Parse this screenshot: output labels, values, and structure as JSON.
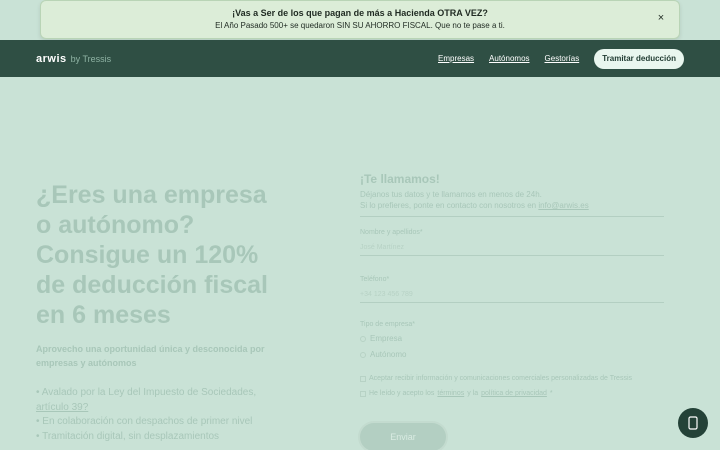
{
  "banner": {
    "title": "¡Vas a Ser de los que pagan de más a Hacienda OTRA VEZ?",
    "text": "El Año Pasado 500+ se quedaron SIN SU AHORRO FISCAL. Que no te pase a ti.",
    "close_glyph": "×"
  },
  "header": {
    "brand_main": "arwis",
    "brand_sub": "by Tressis",
    "nav": [
      "Empresas",
      "Autónomos",
      "Gestorías"
    ],
    "cta": "Tramitar deducción"
  },
  "hero": {
    "title_lines": [
      "¿Eres una empresa",
      "o autónomo?",
      "Consigue un 120%",
      "de deducción fiscal",
      "en 6 meses"
    ],
    "subtitle": "Aprovecho una oportunidad única y desconocida por empresas y autónomos",
    "bullets": [
      {
        "text": "• Avalado por la Ley del Impuesto de Sociedades,",
        "link": "artículo 39?"
      },
      {
        "text": "• En colaboración con despachos de primer nivel",
        "link": ""
      },
      {
        "text": "• Tramitación digital, sin desplazamientos",
        "link": ""
      }
    ]
  },
  "form": {
    "title": "¡Te llamamos!",
    "desc_line1": "Déjanos tus datos y te llamamos en menos de 24h.",
    "desc_line2_prefix": "Si lo prefieres, ponte en contacto con nosotros en",
    "desc_email": "info@arwis.es",
    "name_label": "Nombre y apellidos*",
    "name_placeholder": "José Martínez",
    "phone_label": "Teléfono*",
    "phone_placeholder": "+34 123 456 789",
    "company_type_label": "Tipo de empresa*",
    "options": [
      "Empresa",
      "Autónomo"
    ],
    "consent_text": "Aceptar recibir información y comunicaciones comerciales personalizadas de Tressis",
    "terms_prefix": "He leído y acepto los",
    "terms_link": "términos",
    "terms_mid": "y la",
    "privacy_link": "política de privacidad",
    "terms_suffix": "*",
    "submit": "Enviar"
  }
}
